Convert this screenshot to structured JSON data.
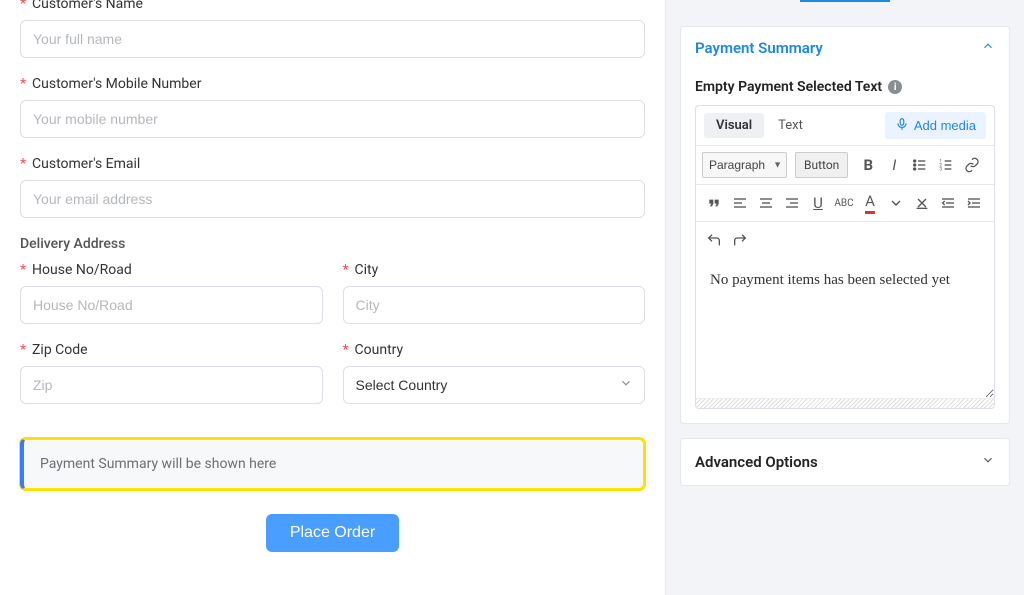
{
  "form": {
    "customer_name": {
      "label": "Customer's Name",
      "placeholder": "Your full name"
    },
    "customer_mobile": {
      "label": "Customer's Mobile Number",
      "placeholder": "Your mobile number"
    },
    "customer_email": {
      "label": "Customer's Email",
      "placeholder": "Your email address"
    },
    "delivery_section": "Delivery Address",
    "house": {
      "label": "House No/Road",
      "placeholder": "House No/Road"
    },
    "city": {
      "label": "City",
      "placeholder": "City"
    },
    "zip": {
      "label": "Zip Code",
      "placeholder": "Zip"
    },
    "country": {
      "label": "Country",
      "placeholder": "Select Country"
    },
    "payment_summary_placeholder": "Payment Summary will be shown here",
    "submit": "Place Order"
  },
  "sidebar": {
    "payment_summary": {
      "title": "Payment Summary",
      "empty_text_label": "Empty Payment Selected Text",
      "editor": {
        "tabs": {
          "visual": "Visual",
          "text": "Text"
        },
        "add_media": "Add media",
        "paragraph_label": "Paragraph",
        "button_label": "Button",
        "content": "No payment items has been selected yet"
      }
    },
    "advanced": {
      "title": "Advanced Options"
    }
  },
  "colors": {
    "accent": "#1e88e5",
    "highlight": "#ffe000",
    "primary_btn": "#4a9eff"
  }
}
